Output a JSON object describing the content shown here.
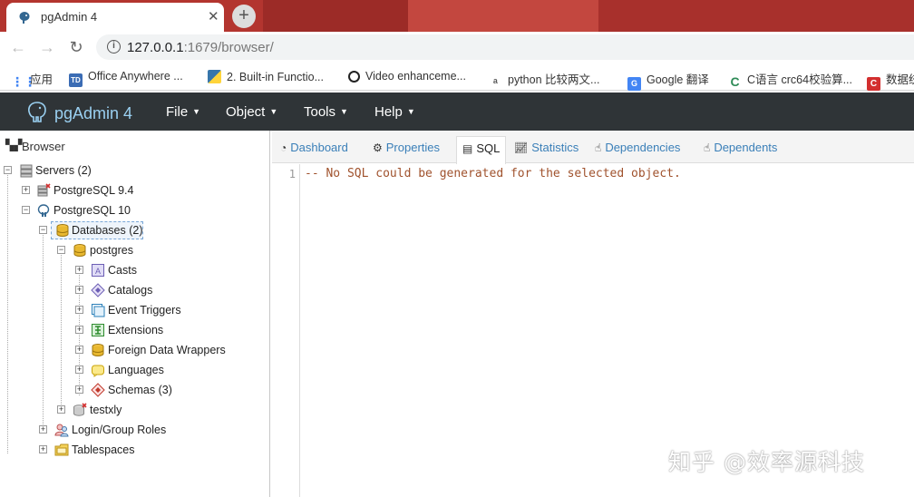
{
  "browser": {
    "tab_title": "pgAdmin 4",
    "close_symbol": "✕",
    "new_tab_symbol": "+",
    "url_host": "127.0.0.1",
    "url_rest": ":1679/browser/",
    "bookmarks": [
      {
        "label": "应用",
        "icon": "apps-grid-icon",
        "color": "#4285f4"
      },
      {
        "label": "Office Anywhere ...",
        "icon": "td-icon",
        "color": "#3b6cb4"
      },
      {
        "label": "2. Built-in Functio...",
        "icon": "python-icon",
        "color": "#3776ab"
      },
      {
        "label": "Video enhanceme...",
        "icon": "circle-icon",
        "color": "#222222"
      },
      {
        "label": "python 比较两文...",
        "icon": "flask-icon",
        "color": "#555555"
      },
      {
        "label": "Google 翻译",
        "icon": "google-translate-icon",
        "color": "#4285f4"
      },
      {
        "label": "C语言 crc64校验算...",
        "icon": "c-green-icon",
        "color": "#2e8b57"
      },
      {
        "label": "数据统",
        "icon": "c-red-icon",
        "color": "#d32f2f"
      }
    ]
  },
  "pgadmin": {
    "brand": "pgAdmin 4",
    "menus": [
      "File",
      "Object",
      "Tools",
      "Help"
    ]
  },
  "browser_panel": {
    "title": "Browser",
    "tree": [
      {
        "label": "Servers (2)",
        "icon": "servers-icon"
      },
      {
        "label": "PostgreSQL 9.4",
        "icon": "server-disconnected-icon"
      },
      {
        "label": "PostgreSQL 10",
        "icon": "server-connected-icon"
      },
      {
        "label": "Databases (2)",
        "icon": "databases-icon"
      },
      {
        "label": "postgres",
        "icon": "database-icon"
      },
      {
        "label": "Casts",
        "icon": "casts-icon"
      },
      {
        "label": "Catalogs",
        "icon": "catalogs-icon"
      },
      {
        "label": "Event Triggers",
        "icon": "event-triggers-icon"
      },
      {
        "label": "Extensions",
        "icon": "extensions-icon"
      },
      {
        "label": "Foreign Data Wrappers",
        "icon": "foreign-data-wrappers-icon"
      },
      {
        "label": "Languages",
        "icon": "languages-icon"
      },
      {
        "label": "Schemas (3)",
        "icon": "schemas-icon"
      },
      {
        "label": "testxly",
        "icon": "database-disconnected-icon"
      },
      {
        "label": "Login/Group Roles",
        "icon": "login-roles-icon"
      },
      {
        "label": "Tablespaces",
        "icon": "tablespaces-icon"
      }
    ]
  },
  "main_panel": {
    "tabs": [
      "Dashboard",
      "Properties",
      "SQL",
      "Statistics",
      "Dependencies",
      "Dependents"
    ],
    "active_tab": "SQL",
    "line_number": "1",
    "sql_text": "-- No SQL could be generated for the selected object."
  },
  "watermark": "知乎 @效率源科技",
  "colors": {
    "pgadmin_nav_bg": "#2f3437",
    "brand_blue": "#9ad0f1",
    "tab_link_blue": "#3a7fb8",
    "sql_comment": "#a0522d"
  }
}
